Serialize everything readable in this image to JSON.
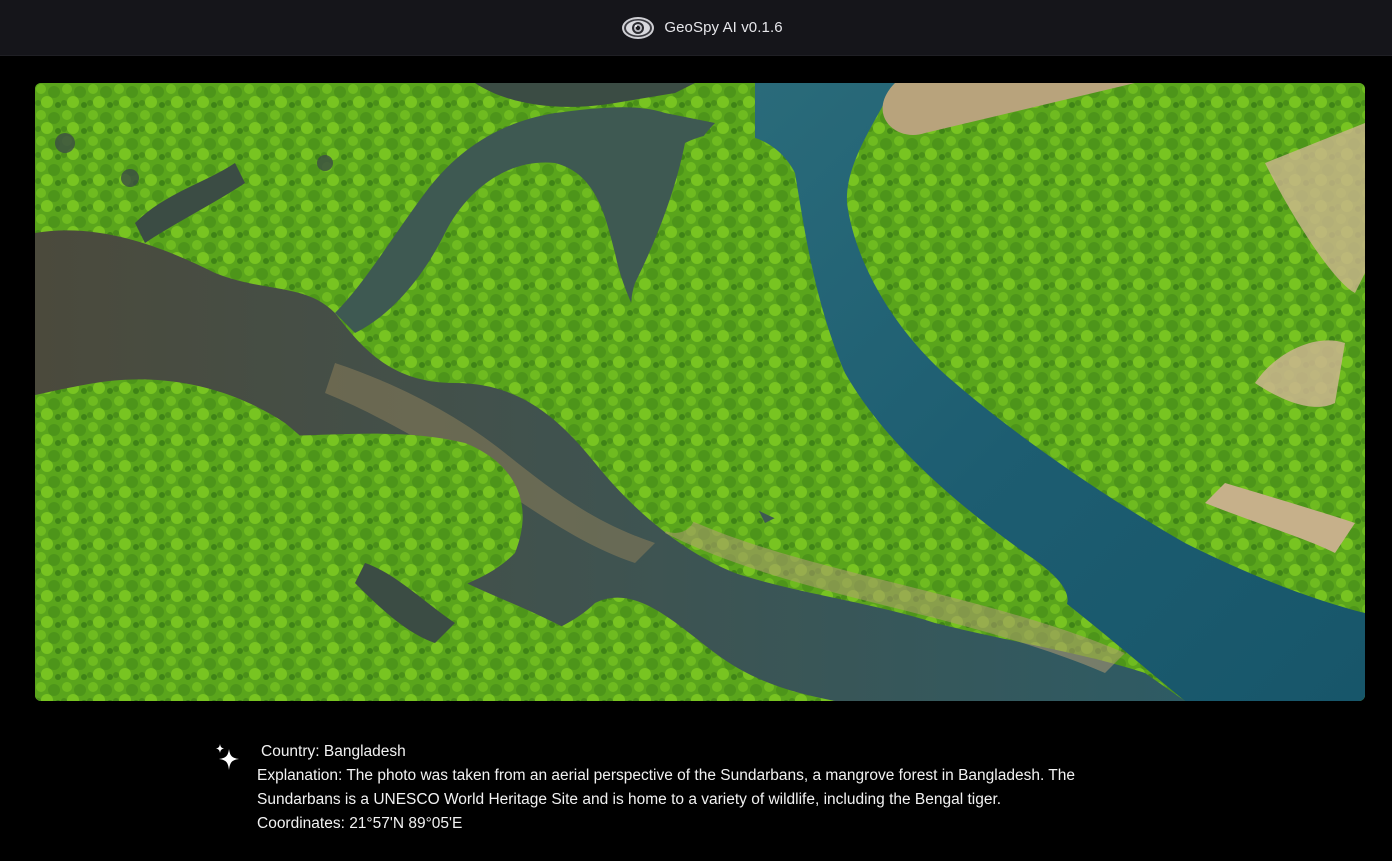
{
  "header": {
    "app_title": "GeoSpy AI v0.1.6",
    "logo_icon": "eye-icon",
    "background": "#15151a"
  },
  "photo": {
    "alt": "Aerial view of mangrove forest and rivers",
    "colors": {
      "forest": "#5aa51c",
      "forest_light": "#7cc21e",
      "river": "#1d5d71",
      "mudflat": "#57513f",
      "sand": "#cdb58f"
    }
  },
  "result": {
    "icon": "sparkle-icon",
    "country_line": "Country: Bangladesh",
    "explanation_line": "Explanation: The photo was taken from an aerial perspective of the Sundarbans, a mangrove forest in Bangladesh. The Sundarbans is a UNESCO World Heritage Site and is home to a variety of wildlife, including the Bengal tiger.",
    "coordinates_line": "Coordinates: 21°57'N 89°05'E"
  }
}
